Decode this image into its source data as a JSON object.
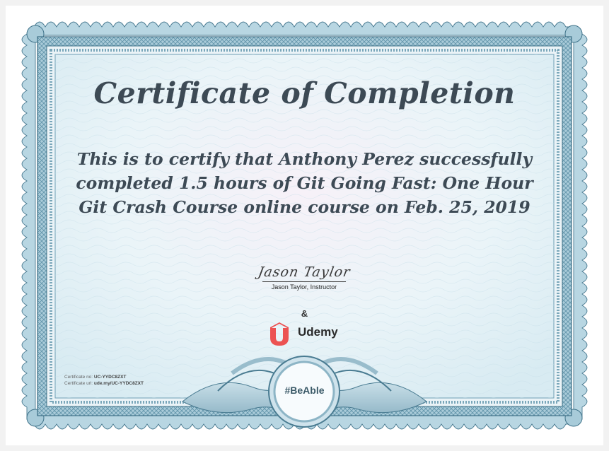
{
  "certificate": {
    "title": "Certificate of Completion",
    "body": "This is to certify that Anthony Perez successfully completed 1.5 hours of Git Going Fast: One Hour Git Crash Course online course on Feb. 25, 2019",
    "signature": {
      "script_name": "Jason Taylor",
      "caption": "Jason Taylor, Instructor"
    },
    "ampersand": "&",
    "brand": {
      "name": "Udemy",
      "accent_color": "#ec5252"
    },
    "meta": {
      "number_label": "Certificate no:",
      "number_value": "UC-YYDC8ZXT",
      "url_label": "Certificate url:",
      "url_value": "ude.my/UC-YYDC8ZXT"
    },
    "badge": "#BeAble"
  },
  "colors": {
    "border_blue": "#6f9fb4",
    "border_dark": "#3c6f86",
    "title_text": "#3d4a55",
    "panel_bg": "#eaf3f7"
  }
}
